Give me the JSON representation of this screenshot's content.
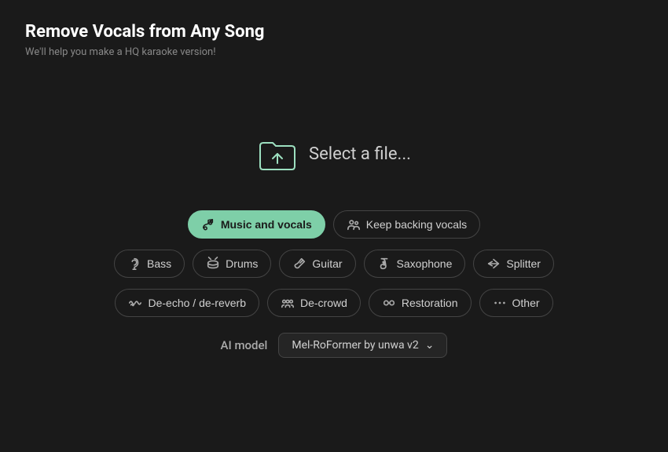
{
  "header": {
    "title": "Remove Vocals from Any Song",
    "subtitle": "We'll help you make a HQ karaoke version!"
  },
  "file_select": {
    "label": "Select a file..."
  },
  "options": {
    "row1": [
      {
        "id": "music-vocals",
        "label": "Music and vocals",
        "icon": "music-vocals-icon",
        "active": true
      },
      {
        "id": "keep-backing",
        "label": "Keep backing vocals",
        "icon": "people-icon",
        "active": false
      }
    ],
    "row2": [
      {
        "id": "bass",
        "label": "Bass",
        "icon": "hearing-icon",
        "active": false
      },
      {
        "id": "drums",
        "label": "Drums",
        "icon": "drums-icon",
        "active": false
      },
      {
        "id": "guitar",
        "label": "Guitar",
        "icon": "guitar-icon",
        "active": false
      },
      {
        "id": "saxophone",
        "label": "Saxophone",
        "icon": "sax-icon",
        "active": false
      },
      {
        "id": "splitter",
        "label": "Splitter",
        "icon": "splitter-icon",
        "active": false
      }
    ],
    "row3": [
      {
        "id": "deecho",
        "label": "De-echo / de-reverb",
        "icon": "wave-icon",
        "active": false
      },
      {
        "id": "decrowd",
        "label": "De-crowd",
        "icon": "decrowd-icon",
        "active": false
      },
      {
        "id": "restoration",
        "label": "Restoration",
        "icon": "restoration-icon",
        "active": false
      },
      {
        "id": "other",
        "label": "Other",
        "icon": "dots-icon",
        "active": false
      }
    ]
  },
  "ai_model": {
    "label": "AI model",
    "value": "Mel-RoFormer by unwa v2"
  }
}
